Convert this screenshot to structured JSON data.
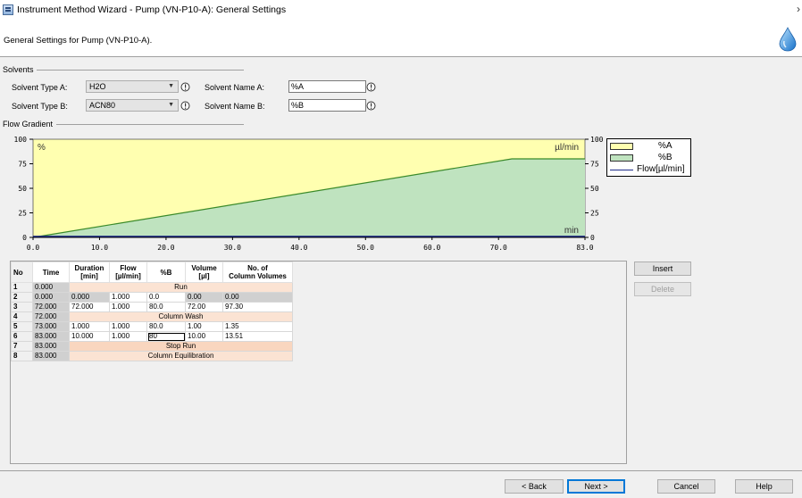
{
  "window": {
    "title": "Instrument Method Wizard - Pump (VN-P10-A): General Settings",
    "close_glyph": "›"
  },
  "header": {
    "description": "General Settings for Pump (VN-P10-A)."
  },
  "solvents": {
    "group_label": "Solvents",
    "type_a_label": "Solvent Type A:",
    "type_a_value": "H2O",
    "type_b_label": "Solvent Type B:",
    "type_b_value": "ACN80",
    "name_a_label": "Solvent Name A:",
    "name_a_value": "%A",
    "name_b_label": "Solvent Name B:",
    "name_b_value": "%B"
  },
  "flow_gradient": {
    "group_label": "Flow Gradient",
    "chart_data": {
      "type": "area",
      "x_ticks": [
        "0.0",
        "10.0",
        "20.0",
        "30.0",
        "40.0",
        "50.0",
        "60.0",
        "70.0",
        "83.0"
      ],
      "x_tick_values": [
        0,
        10,
        20,
        30,
        40,
        50,
        60,
        70,
        83
      ],
      "xlim": [
        0,
        83
      ],
      "y_left_ticks": [
        "100",
        "75",
        "50",
        "25",
        "0"
      ],
      "y_right_ticks": [
        "100",
        "75",
        "50",
        "25",
        "0"
      ],
      "ylim": [
        0,
        100
      ],
      "left_unit": "%",
      "right_unit": "µl/min",
      "x_unit": "min",
      "series": [
        {
          "name": "%A",
          "color": "#ffffb0"
        },
        {
          "name": "%B",
          "color": "#bfe3bf",
          "points": [
            [
              0,
              0
            ],
            [
              72,
              80
            ],
            [
              83,
              80
            ]
          ]
        },
        {
          "name": "Flow[µl/min]",
          "color": "#1f2d8a",
          "points": [
            [
              0,
              1
            ],
            [
              83,
              1
            ]
          ]
        }
      ]
    }
  },
  "table": {
    "headers": [
      "No",
      "Time",
      "Duration\n[min]",
      "Flow\n[µl/min]",
      "%B",
      "Volume\n[µl]",
      "No. of\nColumn Volumes"
    ],
    "rows": [
      {
        "no": "1",
        "time": "0.000",
        "span": "Run"
      },
      {
        "no": "2",
        "time": "0.000",
        "duration": "0.000",
        "flow": "1.000",
        "b": "0.0",
        "volume": "0.00",
        "cv": "0.00"
      },
      {
        "no": "3",
        "time": "72.000",
        "duration": "72.000",
        "flow": "1.000",
        "b": "80.0",
        "volume": "72.00",
        "cv": "97.30"
      },
      {
        "no": "4",
        "time": "72.000",
        "span": "Column Wash"
      },
      {
        "no": "5",
        "time": "73.000",
        "duration": "1.000",
        "flow": "1.000",
        "b": "80.0",
        "volume": "1.00",
        "cv": "1.35"
      },
      {
        "no": "6",
        "time": "83.000",
        "duration": "10.000",
        "flow": "1.000",
        "b": "80",
        "volume": "10.00",
        "cv": "13.51"
      },
      {
        "no": "7",
        "time": "83.000",
        "span": "Stop Run"
      },
      {
        "no": "8",
        "time": "83.000",
        "span": "Column Equilibration"
      }
    ]
  },
  "buttons": {
    "insert": "Insert",
    "delete": "Delete",
    "back": "< Back",
    "next": "Next >",
    "cancel": "Cancel",
    "help": "Help"
  }
}
